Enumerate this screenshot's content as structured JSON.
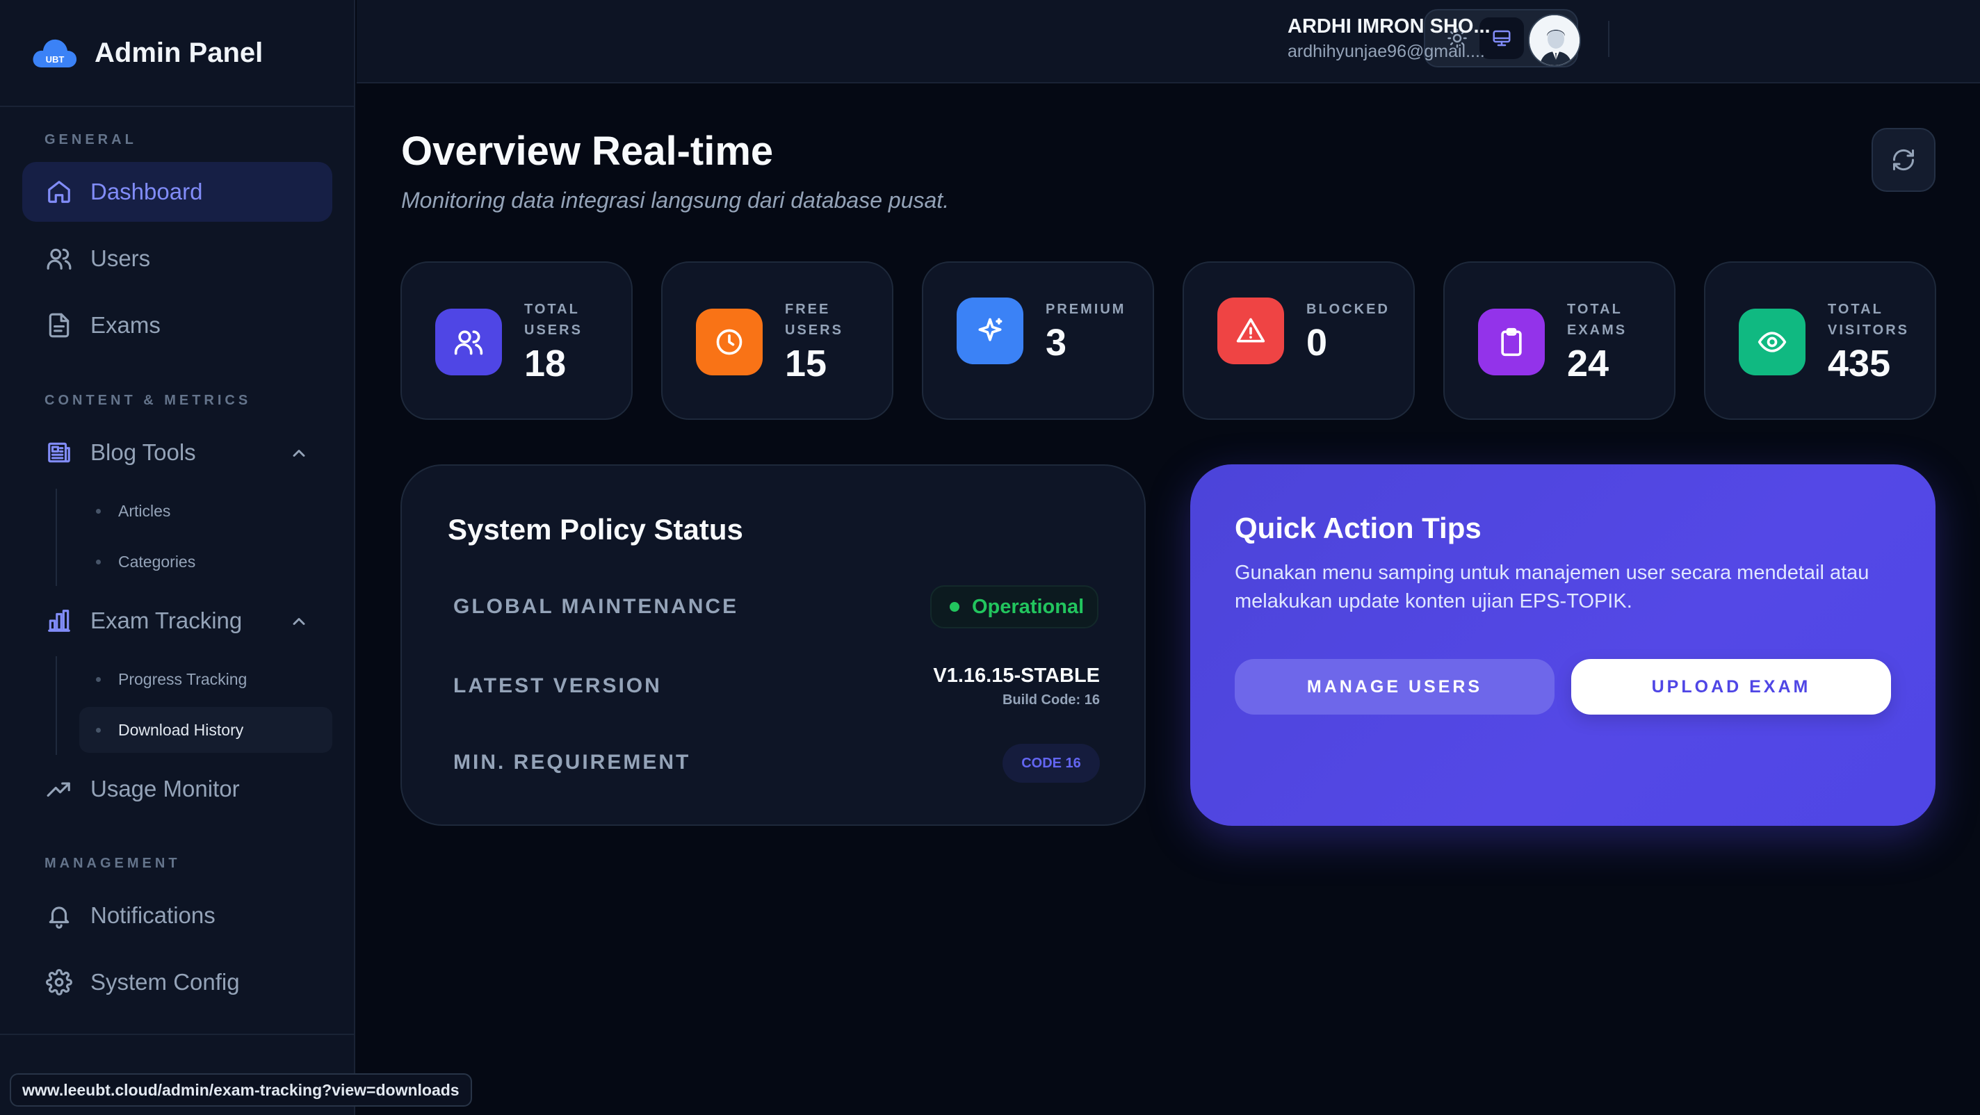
{
  "brand": {
    "title": "Admin Panel",
    "logo_text": "UBT"
  },
  "sidebar": {
    "sections": [
      {
        "label": "GENERAL"
      },
      {
        "label": "CONTENT & METRICS"
      },
      {
        "label": "MANAGEMENT"
      }
    ],
    "items": {
      "dashboard": "Dashboard",
      "users": "Users",
      "exams": "Exams",
      "blog_tools": "Blog Tools",
      "articles": "Articles",
      "categories": "Categories",
      "exam_tracking": "Exam Tracking",
      "progress_tracking": "Progress Tracking",
      "download_history": "Download History",
      "usage_monitor": "Usage Monitor",
      "notifications": "Notifications",
      "system_config": "System Config"
    }
  },
  "header": {
    "user_name": "ARDHI IMRON SHO...",
    "user_email": "ardhihyunjae96@gmail...."
  },
  "main": {
    "title": "Overview Real-time",
    "subtitle": "Monitoring data integrasi langsung dari database pusat."
  },
  "stats": [
    {
      "label": "TOTAL USERS",
      "value": "18",
      "color": "#4f46e5"
    },
    {
      "label": "FREE USERS",
      "value": "15",
      "color": "#f97316"
    },
    {
      "label": "PREMIUM",
      "value": "3",
      "color": "#3b82f6"
    },
    {
      "label": "BLOCKED",
      "value": "0",
      "color": "#ef4444"
    },
    {
      "label": "TOTAL EXAMS",
      "value": "24",
      "color": "#9333ea"
    },
    {
      "label": "TOTAL VISITORS",
      "value": "435",
      "color": "#10b981"
    }
  ],
  "policy": {
    "title": "System Policy Status",
    "maintenance_label": "GLOBAL MAINTENANCE",
    "maintenance_status": "Operational",
    "version_label": "LATEST VERSION",
    "version_value": "V1.16.15-STABLE",
    "build_code": "Build Code: 16",
    "min_req_label": "MIN. REQUIREMENT",
    "min_req_value": "CODE 16"
  },
  "tips": {
    "title": "Quick Action Tips",
    "text": "Gunakan menu samping untuk manajemen user secara mendetail atau melakukan update konten ujian EPS-TOPIK.",
    "manage_users": "MANAGE USERS",
    "upload_exam": "UPLOAD EXAM"
  },
  "status_bar": {
    "url": "www.leeubt.cloud/admin/exam-tracking?view=downloads"
  },
  "colors": {
    "accent": "#6366f1",
    "success": "#22c55e",
    "background": "#050914"
  }
}
